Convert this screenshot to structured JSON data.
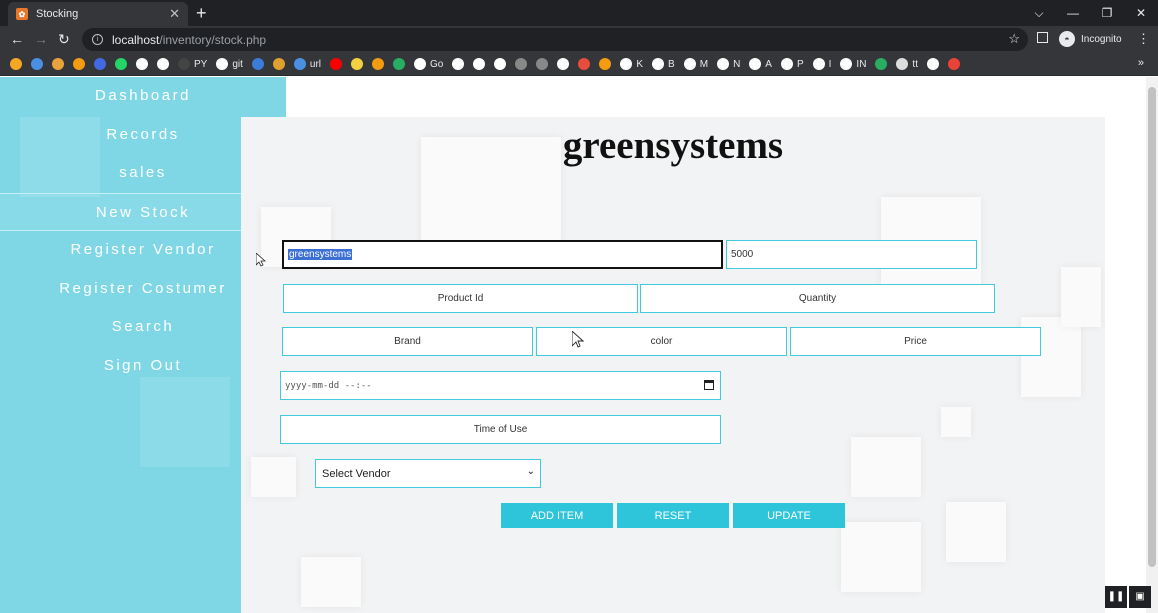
{
  "browser": {
    "tab_title": "Stocking",
    "tab_close": "✕",
    "new_tab": "+",
    "window_controls": [
      "⌵",
      "—",
      "❐",
      "✕"
    ],
    "url_host": "localhost",
    "url_path": "/inventory/stock.php",
    "incognito_label": "Incognito",
    "bookmarks": [
      {
        "label": "",
        "color": "#f5a623"
      },
      {
        "label": "",
        "color": "#4a90e2"
      },
      {
        "label": "",
        "color": "#e8a33d"
      },
      {
        "label": "",
        "color": "#f39c12"
      },
      {
        "label": "",
        "color": "#4169e1"
      },
      {
        "label": "",
        "color": "#25d366"
      },
      {
        "label": "",
        "color": "#ffffff"
      },
      {
        "label": "",
        "color": "#ffffff"
      },
      {
        "label": "PY",
        "color": "#444444"
      },
      {
        "label": "git",
        "color": "#ffffff"
      },
      {
        "label": "",
        "color": "#3d7bd9"
      },
      {
        "label": "",
        "color": "#e0a030"
      },
      {
        "label": "url",
        "color": "#4a90e2"
      },
      {
        "label": "",
        "color": "#ff0000"
      },
      {
        "label": "",
        "color": "#f4d03f"
      },
      {
        "label": "",
        "color": "#f39c12"
      },
      {
        "label": "",
        "color": "#27ae60"
      },
      {
        "label": "Go",
        "color": "#ffffff"
      },
      {
        "label": "",
        "color": "#ffffff"
      },
      {
        "label": "",
        "color": "#ffffff"
      },
      {
        "label": "",
        "color": "#ffffff"
      },
      {
        "label": "",
        "color": "#888888"
      },
      {
        "label": "",
        "color": "#888888"
      },
      {
        "label": "",
        "color": "#ffffff"
      },
      {
        "label": "",
        "color": "#e74c3c"
      },
      {
        "label": "",
        "color": "#f39c12"
      },
      {
        "label": "K",
        "color": "#ffffff"
      },
      {
        "label": "B",
        "color": "#ffffff"
      },
      {
        "label": "M",
        "color": "#ffffff"
      },
      {
        "label": "N",
        "color": "#ffffff"
      },
      {
        "label": "A",
        "color": "#ffffff"
      },
      {
        "label": "P",
        "color": "#ffffff"
      },
      {
        "label": "I",
        "color": "#ffffff"
      },
      {
        "label": "IN",
        "color": "#ffffff"
      },
      {
        "label": "",
        "color": "#27ae60"
      },
      {
        "label": "tt",
        "color": "#dddddd"
      },
      {
        "label": "",
        "color": "#ffffff"
      },
      {
        "label": "",
        "color": "#ea4335"
      }
    ],
    "bookmarks_more": "»"
  },
  "sidebar": {
    "items": [
      {
        "label": "Dashboard",
        "active": false
      },
      {
        "label": "Records",
        "active": false
      },
      {
        "label": "sales",
        "active": false
      },
      {
        "label": "New Stock",
        "active": true
      },
      {
        "label": "Register Vendor",
        "active": false
      },
      {
        "label": "Register Costumer",
        "active": false
      },
      {
        "label": "Search",
        "active": false
      },
      {
        "label": "Sign Out",
        "active": false
      }
    ]
  },
  "main": {
    "site_title": "greensystems",
    "form": {
      "name_value": "greensystems",
      "price_value": "5000",
      "product_id_placeholder": "Product Id",
      "quantity_placeholder": "Quantity",
      "brand_placeholder": "Brand",
      "color_placeholder": "color",
      "price_placeholder": "Price",
      "datetime_placeholder": "yyyy-mm-dd --:--",
      "time_of_use_placeholder": "Time of Use",
      "vendor_select_value": "Select Vendor"
    },
    "buttons": {
      "add_item": "ADD ITEM",
      "reset": "RESET",
      "update": "UPDATE"
    }
  },
  "colors": {
    "sidebar_bg": "#7fd7e6",
    "accent": "#2ec4da",
    "field_border": "#41c9dd"
  }
}
